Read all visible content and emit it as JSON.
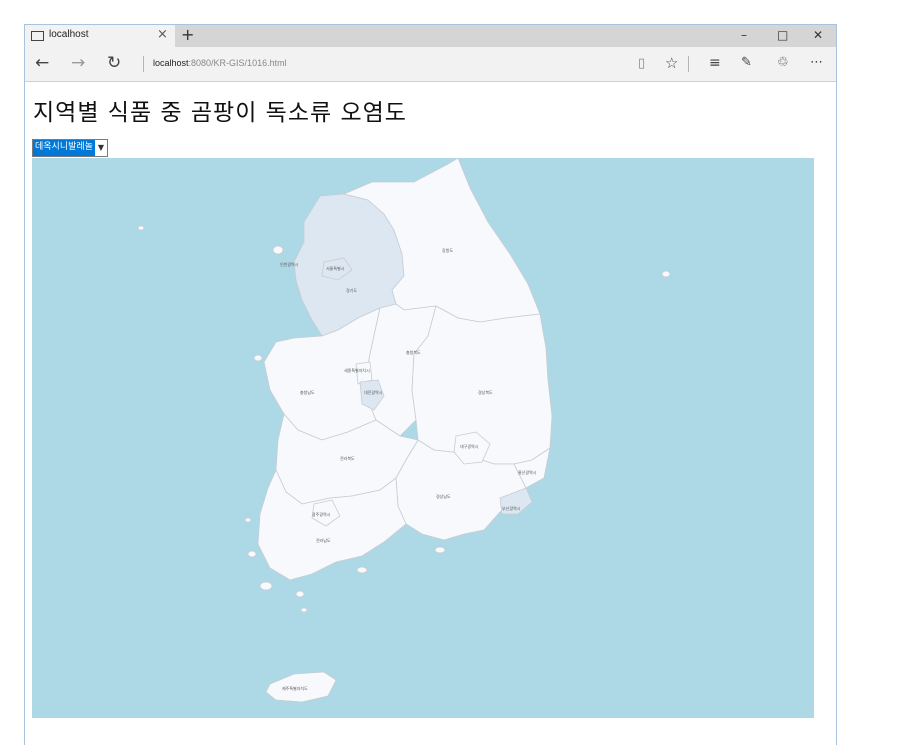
{
  "browser": {
    "tab_title": "localhost",
    "tab_close": "×",
    "new_tab": "+",
    "url_host": "localhost",
    "url_rest": ":8080/KR-GIS/1016.html",
    "win_min": "–",
    "win_max": "□",
    "win_close": "✕",
    "icons": [
      "page-icon",
      "back-icon",
      "forward-icon",
      "refresh-icon",
      "reading-view-icon",
      "favorite-star-icon",
      "hub-icon",
      "web-note-icon",
      "share-icon",
      "more-icon"
    ]
  },
  "page": {
    "title": "지역별 식품 중 곰팡이 독소류 오염도",
    "select_value": "데옥시니발레놀"
  },
  "map": {
    "sea_color": "#add8e6",
    "land_color": "#f7f9fc",
    "highlight_color": "#dde7f2",
    "regions": {
      "incheon": "인천광역시",
      "seoul": "서울특별시",
      "gyeonggi": "경기도",
      "gangwon": "강원도",
      "chungbuk": "충청북도",
      "sejong": "세종특별자치시",
      "daejeon": "대전광역시",
      "chungnam": "충청남도",
      "gyeongbuk": "경상북도",
      "daegu": "대구광역시",
      "jeonbuk": "전라북도",
      "ulsan": "울산광역시",
      "gyeongnam": "경상남도",
      "busan": "부산광역시",
      "gwangju": "광주광역시",
      "jeonnam": "전라남도",
      "jeju": "제주특별자치도"
    }
  }
}
